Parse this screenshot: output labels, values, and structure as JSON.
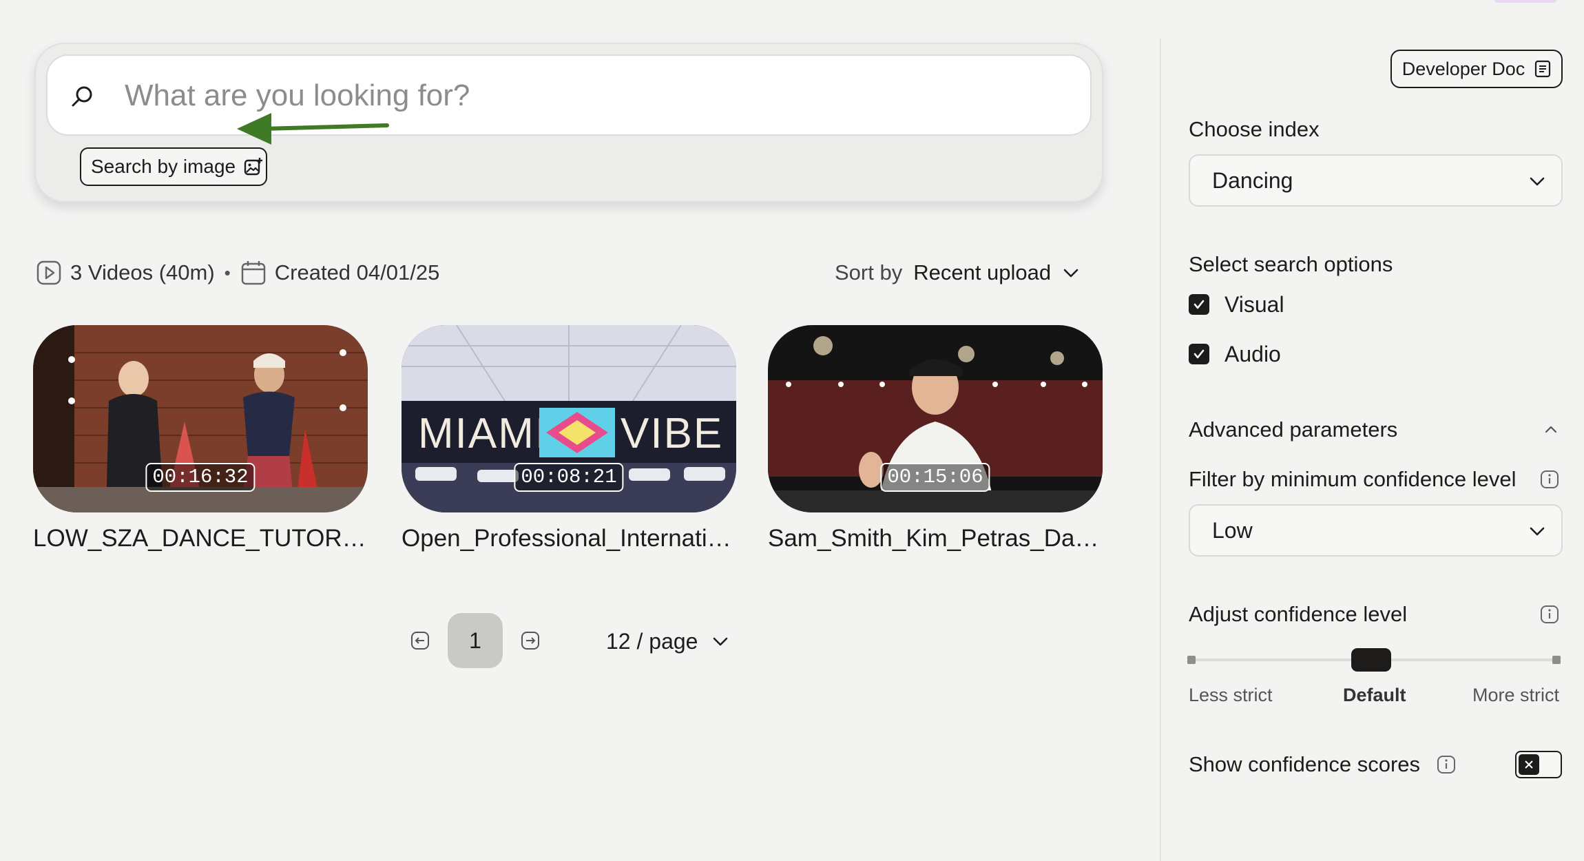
{
  "search": {
    "placeholder": "What are you looking for?",
    "image_button_label": "Search by image"
  },
  "meta": {
    "videos_label": "3 Videos (40m)",
    "separator": "•",
    "created_label": "Created 04/01/25"
  },
  "sort": {
    "label": "Sort by",
    "value": "Recent upload"
  },
  "videos": [
    {
      "title": "LOW_SZA_DANCE_TUTORIAL",
      "duration": "00:16:32"
    },
    {
      "title": "Open_Professional_International",
      "duration": "00:08:21"
    },
    {
      "title": "Sam_Smith_Kim_Petras_Dance",
      "duration": "00:15:06"
    }
  ],
  "pagination": {
    "current_page": "1",
    "page_size": "12 / page"
  },
  "panel": {
    "dev_doc_label": "Developer Doc",
    "choose_index_label": "Choose index",
    "index_value": "Dancing",
    "search_options_label": "Select search options",
    "options": [
      {
        "label": "Visual",
        "checked": true
      },
      {
        "label": "Audio",
        "checked": true
      }
    ],
    "advanced_label": "Advanced parameters",
    "filter_label": "Filter by minimum confidence level",
    "filter_value": "Low",
    "adjust_label": "Adjust confidence level",
    "slider": {
      "less": "Less strict",
      "default": "Default",
      "more": "More strict",
      "value": 0.5
    },
    "show_scores_label": "Show confidence scores",
    "show_scores_enabled": false
  },
  "colors": {
    "background": "#f3f3f2",
    "text": "#1d1c1b",
    "arrow": "#3f7a26"
  }
}
